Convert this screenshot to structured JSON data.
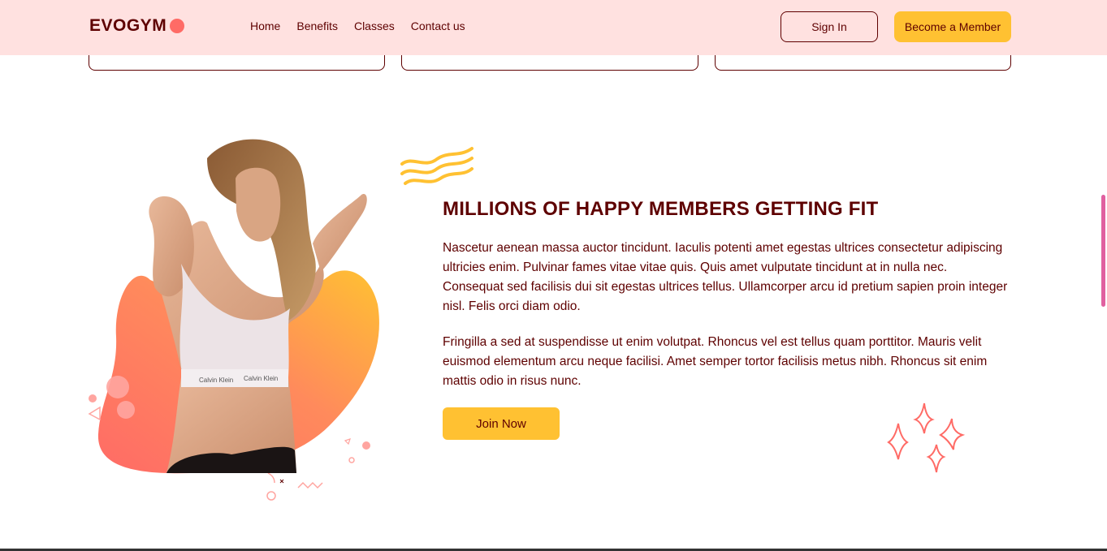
{
  "brand": {
    "name": "EVOGYM"
  },
  "nav": {
    "links": [
      "Home",
      "Benefits",
      "Classes",
      "Contact us"
    ],
    "signin_label": "Sign In",
    "member_label": "Become a Member"
  },
  "section": {
    "heading": "MILLIONS OF HAPPY MEMBERS GETTING FIT",
    "paragraph1": "Nascetur aenean massa auctor tincidunt. Iaculis potenti amet egestas ultrices consectetur adipiscing ultricies enim. Pulvinar fames vitae vitae quis. Quis amet vulputate tincidunt at in nulla nec. Consequat sed facilisis dui sit egestas ultrices tellus. Ullamcorper arcu id pretium sapien proin integer nisl. Felis orci diam odio.",
    "paragraph2": "Fringilla a sed at suspendisse ut enim volutpat. Rhoncus vel est tellus quam porttitor. Mauris velit euismod elementum arcu neque facilisi. Amet semper tortor facilisis metus nibh. Rhoncus sit enim mattis odio in risus nunc.",
    "join_label": "Join Now",
    "image_waistband_text": "Calvin Klein"
  },
  "colors": {
    "nav_bg": "#ffe1e0",
    "primary_text": "#5e0000",
    "accent_yellow": "#ffc132",
    "accent_coral": "#ff6b66"
  },
  "icons": [
    "waves-decoration",
    "sparkles-decoration"
  ]
}
